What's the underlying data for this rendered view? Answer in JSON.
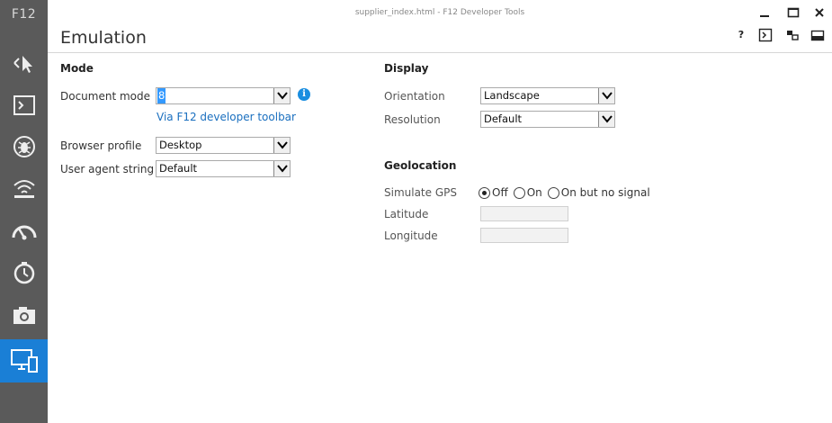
{
  "sidebar": {
    "label": "F12",
    "tools": [
      "dom-explorer-icon",
      "console-icon",
      "debugger-icon",
      "network-icon",
      "ui-responsiveness-icon",
      "profiler-icon",
      "memory-icon",
      "emulation-icon"
    ],
    "active_color": "#1a7fd6"
  },
  "window": {
    "title": "supplier_index.html - F12 Developer Tools"
  },
  "header": {
    "title": "Emulation",
    "help_label": "?"
  },
  "mode": {
    "title": "Mode",
    "document_mode_label": "Document mode",
    "document_mode_value": "8",
    "info_glyph": "i",
    "document_mode_link": "Via F12 developer toolbar",
    "browser_profile_label": "Browser profile",
    "browser_profile_value": "Desktop",
    "user_agent_label": "User agent string",
    "user_agent_value": "Default"
  },
  "display": {
    "title": "Display",
    "orientation_label": "Orientation",
    "orientation_value": "Landscape",
    "resolution_label": "Resolution",
    "resolution_value": "Default"
  },
  "geolocation": {
    "title": "Geolocation",
    "simulate_gps_label": "Simulate GPS",
    "options": [
      "Off",
      "On",
      "On but no signal"
    ],
    "selected": "Off",
    "latitude_label": "Latitude",
    "latitude_value": "",
    "longitude_label": "Longitude",
    "longitude_value": ""
  }
}
